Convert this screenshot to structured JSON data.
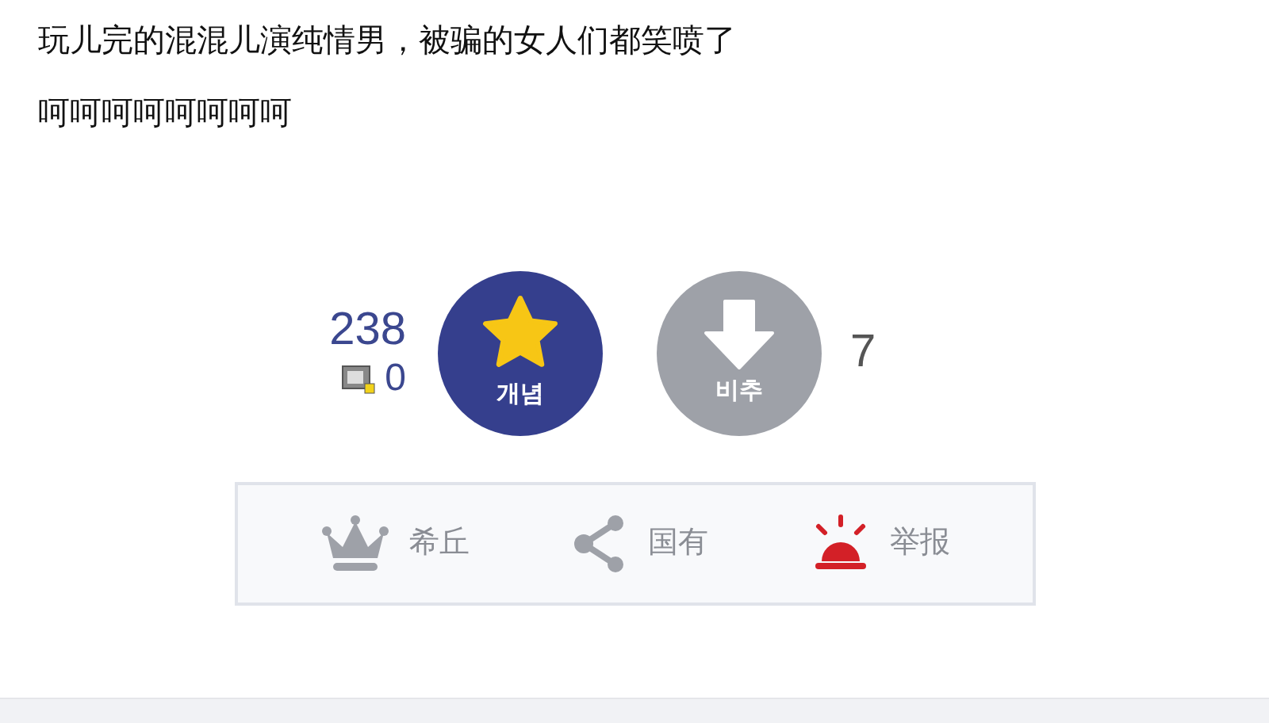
{
  "post": {
    "title": "玩儿完的混混儿演纯情男，被骗的女人们都笑喷了",
    "body": "呵呵呵呵呵呵呵呵"
  },
  "votes": {
    "up_count": "238",
    "fixed_count": "0",
    "up_label": "개념",
    "down_label": "비추",
    "down_count": "7"
  },
  "actions": [
    {
      "kind": "crown",
      "label": "希丘"
    },
    {
      "kind": "share",
      "label": "国有"
    },
    {
      "kind": "alarm",
      "label": "举报"
    }
  ]
}
